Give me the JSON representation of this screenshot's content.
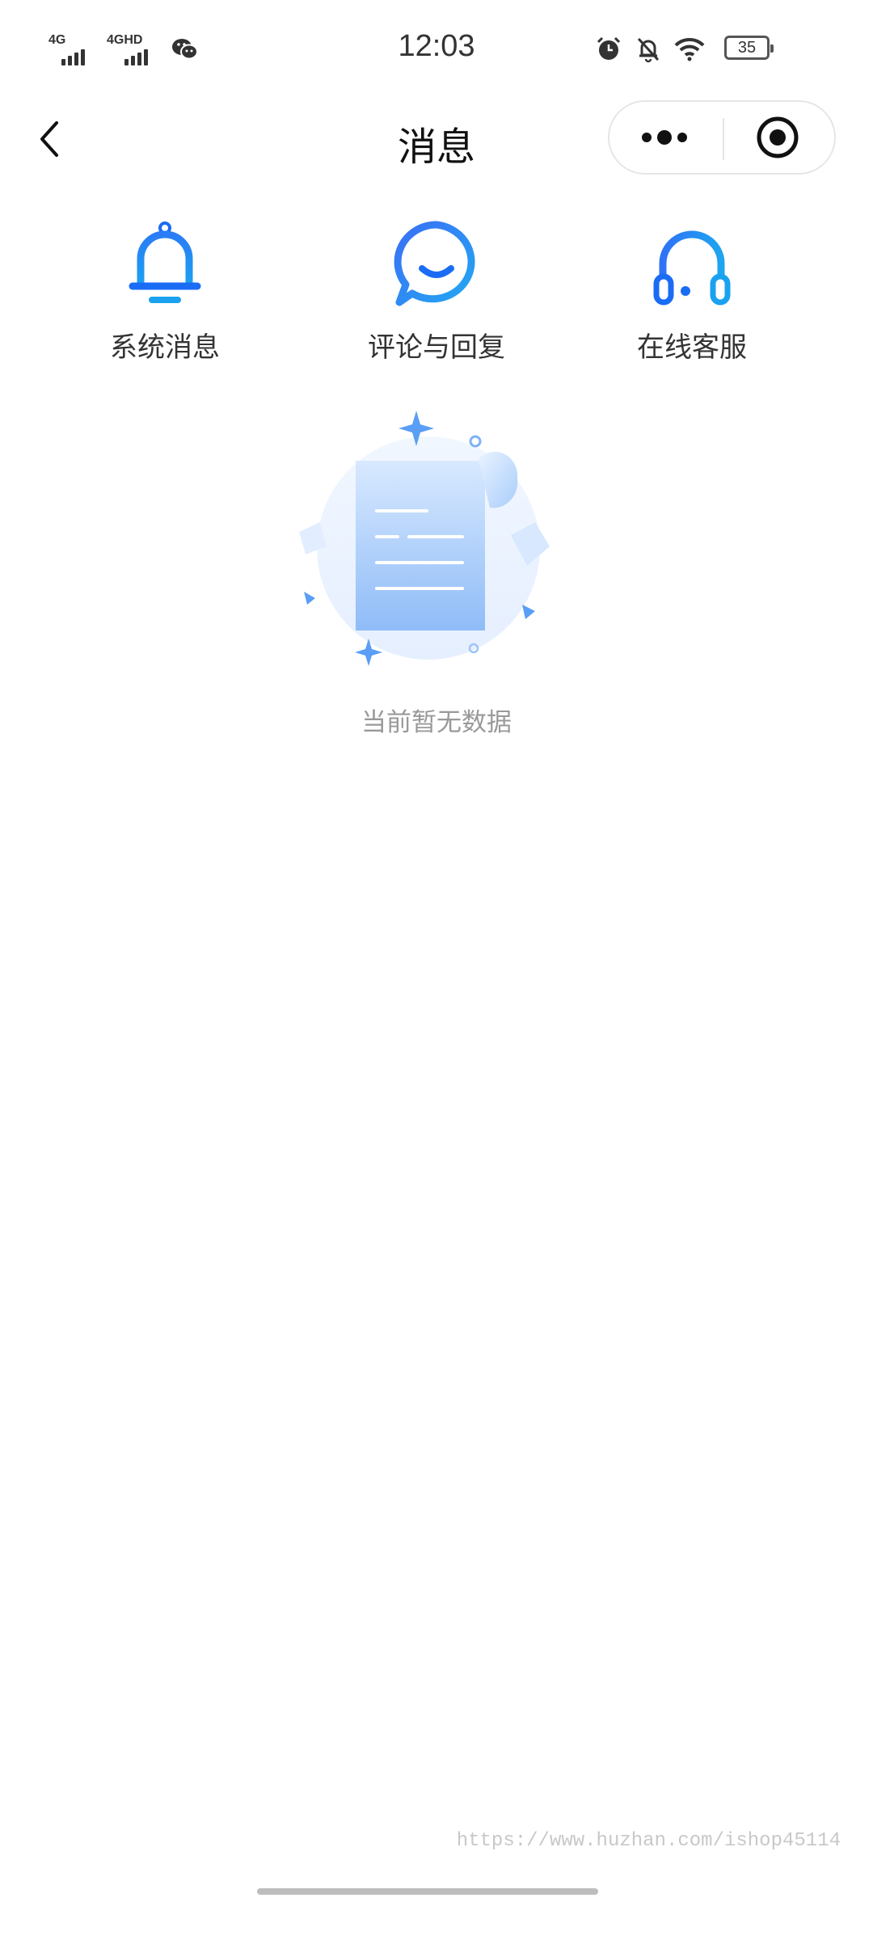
{
  "status_bar": {
    "network_1": "4G",
    "network_2": "4GHD",
    "time": "12:03",
    "battery": "35",
    "icons": [
      "wechat-icon",
      "alarm-icon",
      "bell-off-icon",
      "wifi-icon",
      "battery-icon"
    ]
  },
  "nav": {
    "title": "消息",
    "back_icon": "chevron-left-icon",
    "more_icon": "more-dots-icon",
    "close_icon": "target-circle-icon"
  },
  "categories": [
    {
      "label": "系统消息",
      "icon": "bell-icon"
    },
    {
      "label": "评论与回复",
      "icon": "chat-bubble-icon"
    },
    {
      "label": "在线客服",
      "icon": "headset-icon"
    }
  ],
  "empty_state": {
    "text": "当前暂无数据",
    "icon": "empty-document-icon"
  },
  "watermark": "https://www.huzhan.com/ishop45114",
  "colors": {
    "accent_blue": "#1a6cf5",
    "accent_light": "#2ea6f0",
    "illustration_blue": "#a9cdfb",
    "text_primary": "#333333",
    "text_muted": "#999999"
  }
}
